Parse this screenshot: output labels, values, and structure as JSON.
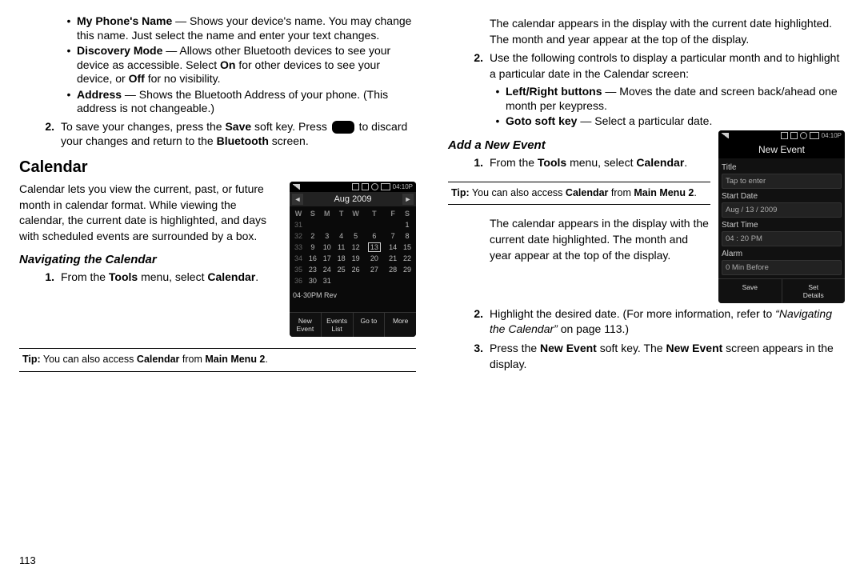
{
  "left": {
    "bullets": [
      {
        "label": "My Phone's Name",
        "text": " — Shows your device's name. You may change this name. Just select the name and enter your text changes."
      },
      {
        "label": "Discovery Mode",
        "text_a": " — Allows other Bluetooth devices to see your device as accessible. Select ",
        "on": "On",
        "text_b": " for other devices to see your device, or ",
        "off": "Off",
        "text_c": " for no visibility."
      },
      {
        "label": "Address",
        "text": " — Shows the Bluetooth Address of your phone. (This address is not changeable.)"
      }
    ],
    "step2_a": "To save your changes, press the ",
    "step2_save": "Save",
    "step2_b": " soft key. Press ",
    "step2_c": " to discard your changes and return to the ",
    "step2_bt": "Bluetooth",
    "step2_d": " screen.",
    "h1": "Calendar",
    "cal_intro": "Calendar lets you view the current, past, or future month in calendar format. While viewing the calendar, the current date is highlighted, and days with scheduled events are surrounded by a box.",
    "h2": "Navigating the Calendar",
    "nav1_a": "From the ",
    "nav1_tools": "Tools",
    "nav1_b": " menu, select ",
    "nav1_cal": "Calendar",
    "nav1_c": ".",
    "tip_a": "Tip:",
    "tip_b": " You can also access ",
    "tip_cal": "Calendar",
    "tip_c": " from ",
    "tip_main": "Main Menu 2",
    "tip_d": ".",
    "pagenum": "113",
    "phone_cal": {
      "status_time": "04:10P",
      "title": "Aug 2009",
      "dow": [
        "W",
        "S",
        "M",
        "T",
        "W",
        "T",
        "F",
        "S"
      ],
      "rows": [
        [
          "31",
          "",
          "",
          "",
          "",
          "",
          "",
          "1"
        ],
        [
          "32",
          "2",
          "3",
          "4",
          "5",
          "6",
          "7",
          "8"
        ],
        [
          "33",
          "9",
          "10",
          "11",
          "12",
          "13",
          "14",
          "15"
        ],
        [
          "34",
          "16",
          "17",
          "18",
          "19",
          "20",
          "21",
          "22"
        ],
        [
          "35",
          "23",
          "24",
          "25",
          "26",
          "27",
          "28",
          "29"
        ],
        [
          "36",
          "30",
          "31",
          "",
          "",
          "",
          "",
          ""
        ]
      ],
      "today_row": 2,
      "today_col": 5,
      "event": "04·30PM Rev",
      "softkeys": [
        "New\nEvent",
        "Events\nList",
        "Go to",
        "More"
      ]
    }
  },
  "right": {
    "para1": "The calendar appears in the display with the current date highlighted. The month and year appear at the top of the display.",
    "step2": "Use the following controls to display a particular month and to highlight a particular date in the Calendar screen:",
    "sub_bullets": [
      {
        "label": "Left/Right buttons",
        "text": " — Moves the date and screen back/ahead one month per keypress."
      },
      {
        "label": "Goto soft key",
        "text": " — Select a particular date."
      }
    ],
    "h2": "Add a New Event",
    "add1_a": "From the ",
    "add1_tools": "Tools",
    "add1_b": " menu, select ",
    "add1_cal": "Calendar",
    "add1_c": ".",
    "tip_a": "Tip:",
    "tip_b": " You can also access ",
    "tip_cal": "Calendar",
    "tip_c": " from ",
    "tip_main": "Main Menu 2",
    "tip_d": ".",
    "para2": "The calendar appears in the display with the current date highlighted. The month and year appear at the top of the display.",
    "step2b_a": "Highlight the desired date. (For more information, refer to ",
    "step2b_ref": "“Navigating the Calendar”",
    "step2b_b": " on page 113.)",
    "step3_a": "Press the ",
    "step3_ne": "New Event",
    "step3_b": " soft key. The ",
    "step3_ne2": "New Event",
    "step3_c": " screen appears in the display.",
    "phone_new": {
      "status_time": "04:10P",
      "title": "New Event",
      "fields": [
        {
          "label": "Title",
          "value": "Tap to enter"
        },
        {
          "label": "Start Date",
          "value": "Aug / 13 / 2009"
        },
        {
          "label": "Start Time",
          "value": "04 : 20 PM"
        },
        {
          "label": "Alarm",
          "value": "0 Min Before"
        }
      ],
      "softkeys": [
        "Save",
        "Set\nDetails"
      ]
    }
  }
}
